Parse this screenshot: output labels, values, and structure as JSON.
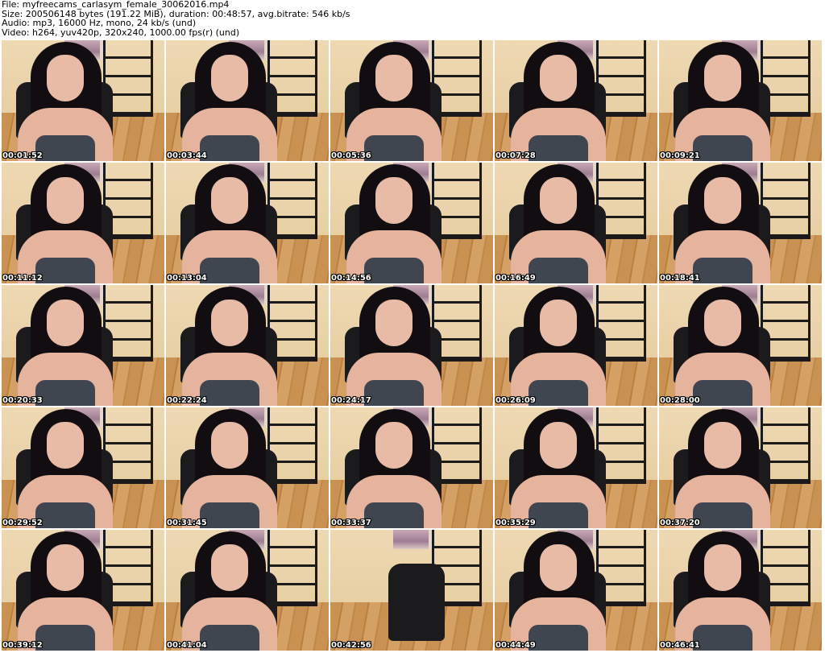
{
  "header": {
    "file": "File: myfreecams_carlasym_female_30062016.mp4",
    "size": "Size: 200506148 bytes (191.22 MiB), duration: 00:48:57, avg.bitrate: 546 kb/s",
    "audio": "Audio: mp3, 16000 Hz, mono, 24 kb/s (und)",
    "video": "Video: h264, yuv420p, 320x240, 1000.00 fps(r) (und)"
  },
  "thumbnails": [
    {
      "timestamp": "00:01:52",
      "scene": "person"
    },
    {
      "timestamp": "00:03:44",
      "scene": "person"
    },
    {
      "timestamp": "00:05:36",
      "scene": "person"
    },
    {
      "timestamp": "00:07:28",
      "scene": "person"
    },
    {
      "timestamp": "00:09:21",
      "scene": "person"
    },
    {
      "timestamp": "00:11:12",
      "scene": "person"
    },
    {
      "timestamp": "00:13:04",
      "scene": "person"
    },
    {
      "timestamp": "00:14:56",
      "scene": "person"
    },
    {
      "timestamp": "00:16:49",
      "scene": "person"
    },
    {
      "timestamp": "00:18:41",
      "scene": "person"
    },
    {
      "timestamp": "00:20:33",
      "scene": "person"
    },
    {
      "timestamp": "00:22:24",
      "scene": "person"
    },
    {
      "timestamp": "00:24:17",
      "scene": "person"
    },
    {
      "timestamp": "00:26:09",
      "scene": "person"
    },
    {
      "timestamp": "00:28:00",
      "scene": "person"
    },
    {
      "timestamp": "00:29:52",
      "scene": "person"
    },
    {
      "timestamp": "00:31:45",
      "scene": "person"
    },
    {
      "timestamp": "00:33:37",
      "scene": "person"
    },
    {
      "timestamp": "00:35:29",
      "scene": "person"
    },
    {
      "timestamp": "00:37:20",
      "scene": "person"
    },
    {
      "timestamp": "00:39:12",
      "scene": "person"
    },
    {
      "timestamp": "00:41:04",
      "scene": "person"
    },
    {
      "timestamp": "00:42:56",
      "scene": "empty-chair"
    },
    {
      "timestamp": "00:44:49",
      "scene": "person"
    },
    {
      "timestamp": "00:46:41",
      "scene": "person"
    }
  ]
}
